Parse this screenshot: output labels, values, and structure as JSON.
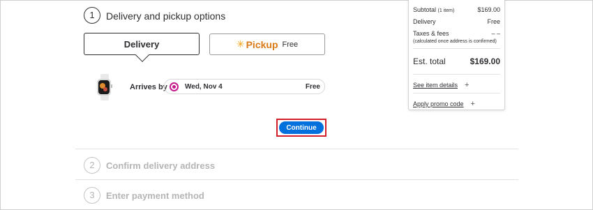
{
  "step1": {
    "number": "1",
    "title": "Delivery and pickup options"
  },
  "options": {
    "delivery_label": "Delivery",
    "pickup_spark": "✳",
    "pickup_brand": "Pickup",
    "pickup_free": "Free"
  },
  "item": {
    "arrives_label": "Arrives by",
    "date": "Wed, Nov 4",
    "price": "Free"
  },
  "continue_label": "Continue",
  "step2": {
    "number": "2",
    "title": "Confirm delivery address"
  },
  "step3": {
    "number": "3",
    "title": "Enter payment method"
  },
  "summary": {
    "subtotal_label": "Subtotal",
    "subtotal_items": "(1 item)",
    "subtotal_value": "$169.00",
    "delivery_label": "Delivery",
    "delivery_value": "Free",
    "taxes_label": "Taxes & fees",
    "taxes_value": "– –",
    "taxes_note": "(calculated once address is confirmed)",
    "est_total_label": "Est. total",
    "est_total_value": "$169.00",
    "item_details_label": "See item details",
    "promo_label": "Apply promo code",
    "plus": "+"
  },
  "colors": {
    "accent": "#0071dc",
    "highlight_box": "#d21d2a",
    "radio": "#c2188b",
    "pickup": "#d97a16"
  }
}
